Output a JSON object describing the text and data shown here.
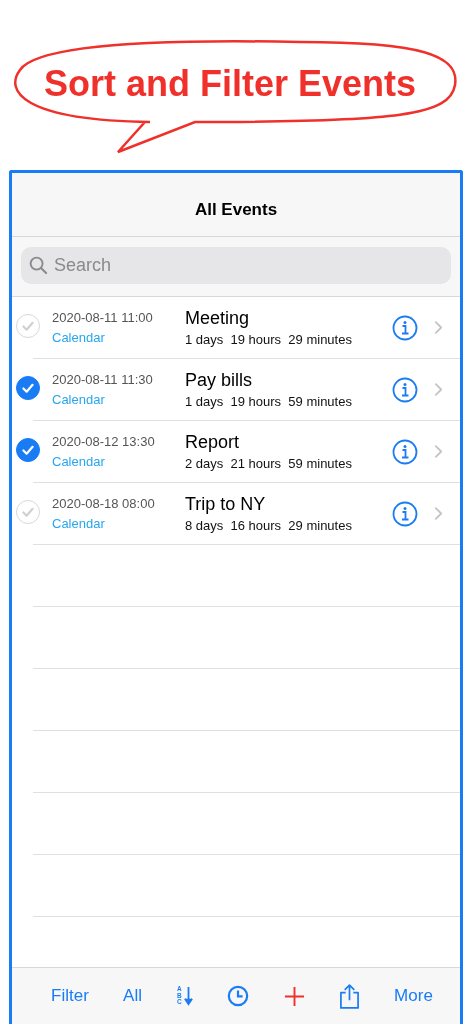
{
  "callout": {
    "text": "Sort and Filter Events"
  },
  "nav_bar": {
    "title": "All Events"
  },
  "search": {
    "placeholder": "Search"
  },
  "events": [
    {
      "checked": false,
      "datetime": "2020-08-11 11:00",
      "calendar": "Calendar",
      "title": "Meeting",
      "countdown": "1 days  19 hours  29 minutes"
    },
    {
      "checked": true,
      "datetime": "2020-08-11 11:30",
      "calendar": "Calendar",
      "title": "Pay bills",
      "countdown": "1 days  19 hours  59 minutes"
    },
    {
      "checked": true,
      "datetime": "2020-08-12 13:30",
      "calendar": "Calendar",
      "title": "Report",
      "countdown": "2 days  21 hours  59 minutes"
    },
    {
      "checked": false,
      "datetime": "2020-08-18 08:00",
      "calendar": "Calendar",
      "title": "Trip to NY",
      "countdown": "8 days  16 hours  29 minutes"
    }
  ],
  "toolbar": [
    {
      "kind": "text",
      "label": "Filter"
    },
    {
      "kind": "text",
      "label": "All"
    },
    {
      "kind": "sort",
      "letters": "ABC"
    },
    {
      "kind": "clock"
    },
    {
      "kind": "add"
    },
    {
      "kind": "share"
    },
    {
      "kind": "text",
      "label": "More"
    }
  ]
}
